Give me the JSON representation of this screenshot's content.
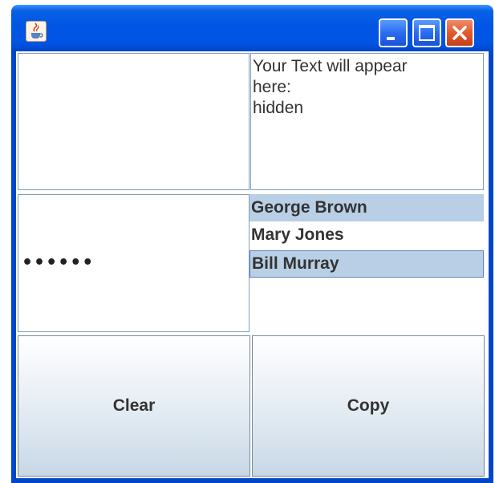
{
  "window": {
    "title": "",
    "controls": [
      "minimize-icon",
      "maximize-icon",
      "close-icon"
    ],
    "app_icon": "java-cup-icon"
  },
  "input_area": {
    "value": ""
  },
  "output_area": {
    "lines": [
      "Your Text will appear",
      "here:",
      "hidden"
    ]
  },
  "password_field": {
    "masked_value": "••••••"
  },
  "name_list": {
    "items": [
      {
        "label": "George Brown",
        "selected": true
      },
      {
        "label": "Mary Jones",
        "selected": false
      },
      {
        "label": "Bill Murray",
        "selected": true,
        "focused": true
      }
    ]
  },
  "buttons": {
    "clear_label": "Clear",
    "copy_label": "Copy"
  },
  "colors": {
    "titlebar": "#0055e5",
    "selection": "#b8cfe5",
    "close_button": "#e25a2e"
  }
}
